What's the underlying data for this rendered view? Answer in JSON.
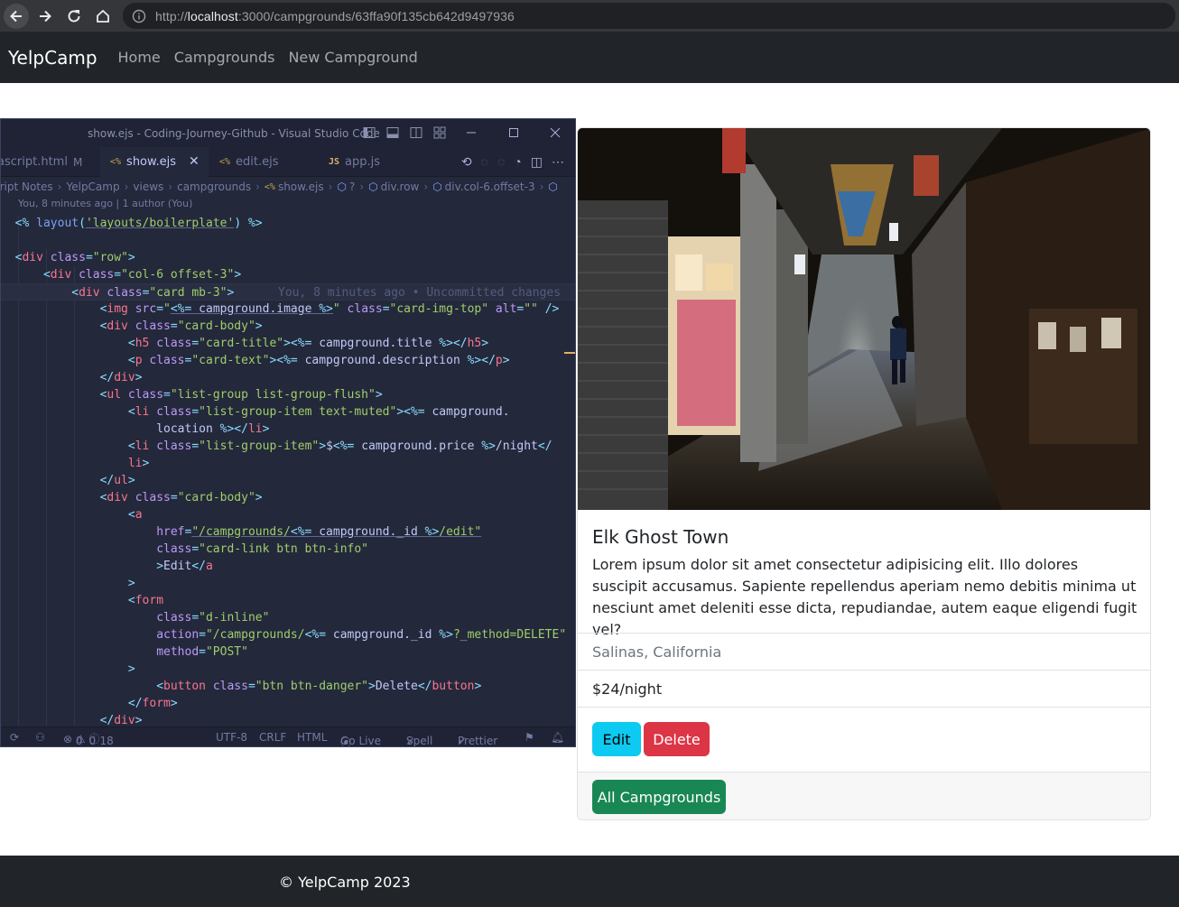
{
  "browser": {
    "url_prefix": "http://",
    "url_host": "localhost",
    "url_rest": ":3000/campgrounds/63ffa90f135cb642d9497936"
  },
  "navbar": {
    "brand": "YelpCamp",
    "links": [
      "Home",
      "Campgrounds",
      "New Campground"
    ]
  },
  "editor": {
    "title": "show.ejs - Coding-Journey-Github - Visual Studio Code",
    "tabs": [
      {
        "label": "ascript.html",
        "badge": "M"
      },
      {
        "label": "show.ejs"
      },
      {
        "label": "edit.ejs"
      },
      {
        "label": "app.js"
      }
    ],
    "tab_glyph_ejs": "<%",
    "tab_glyph_js": "JS",
    "breadcrumb": [
      "cript Notes",
      "YelpCamp",
      "views",
      "campgrounds",
      "show.ejs",
      "?",
      "div.row",
      "div.col-6.offset-3"
    ],
    "blame": "You, 8 minutes ago | 1 author (You)",
    "ghost_text": "You, 8 minutes ago • Uncommitted changes",
    "status": {
      "errors": "0",
      "warnings": "0",
      "info": "18",
      "encoding": "UTF-8",
      "eol": "CRLF",
      "language": "HTML",
      "golive": "Go Live",
      "spell": "Spell",
      "prettier": "Prettier"
    }
  },
  "campground": {
    "title": "Elk Ghost Town",
    "description": "Lorem ipsum dolor sit amet consectetur adipisicing elit. Illo dolores suscipit accusamus. Sapiente repellendus aperiam nemo debitis minima ut nesciunt amet deleniti esse dicta, repudiandae, autem eaque eligendi fugit vel?",
    "location": "Salinas, California",
    "price": "$24/night",
    "edit_label": "Edit",
    "delete_label": "Delete",
    "all_label": "All Campgrounds",
    "image_alt": "covered shopping arcade street at night"
  },
  "footer": {
    "text": "© YelpCamp 2023"
  },
  "colors": {
    "navbar_bg": "#212529",
    "info": "#0dcaf0",
    "danger": "#dc3545",
    "success": "#198754",
    "editor_bg": "#24283b"
  }
}
